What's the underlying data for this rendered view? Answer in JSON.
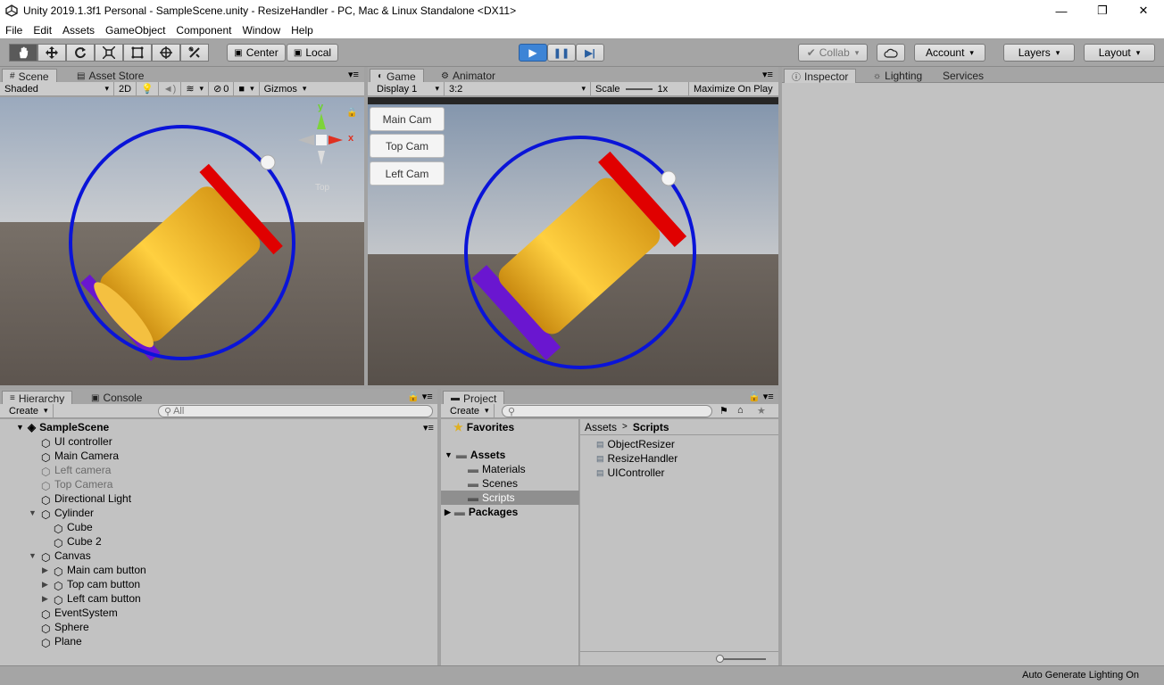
{
  "window": {
    "title": "Unity 2019.1.3f1 Personal - SampleScene.unity - ResizeHandler - PC, Mac & Linux Standalone <DX11>",
    "minimize": "—",
    "maximize": "❐",
    "close": "✕"
  },
  "menu": [
    "File",
    "Edit",
    "Assets",
    "GameObject",
    "Component",
    "Window",
    "Help"
  ],
  "toolbar": {
    "tools": [
      "hand-icon",
      "move-icon",
      "rotate-icon",
      "scale-icon",
      "rect-tool-icon",
      "transform-tool-icon",
      "custom-tool-icon"
    ],
    "pivot": "Center",
    "space": "Local",
    "play": "▶",
    "pause": "❚❚",
    "step": "▶|",
    "collab": "Collab",
    "account": "Account",
    "layers": "Layers",
    "layout": "Layout"
  },
  "scene_panel": {
    "tabs": [
      "Scene",
      "Asset Store"
    ],
    "shading": "Shaded",
    "mode2d": "2D",
    "fx_count": "0",
    "gizmos": "Gizmos",
    "gizmo_label": "Top",
    "axis_y": "y",
    "axis_x": "x"
  },
  "game_panel": {
    "tabs": [
      "Game",
      "Animator"
    ],
    "display": "Display 1",
    "aspect": "3:2",
    "scale_label": "Scale",
    "scale_value": "1x",
    "maximize": "Maximize On Play",
    "buttons": [
      "Main Cam",
      "Top Cam",
      "Left Cam"
    ]
  },
  "inspector": {
    "tabs": [
      "Inspector",
      "Lighting",
      "Services"
    ]
  },
  "hierarchy": {
    "tabs": [
      "Hierarchy",
      "Console"
    ],
    "create": "Create",
    "search_placeholder": "All",
    "scene": "SampleScene",
    "items": [
      {
        "label": "UI controller",
        "dim": false
      },
      {
        "label": "Main Camera",
        "dim": false
      },
      {
        "label": "Left camera",
        "dim": true
      },
      {
        "label": "Top Camera",
        "dim": true
      },
      {
        "label": "Directional Light",
        "dim": false
      },
      {
        "label": "Cylinder",
        "dim": false
      },
      {
        "label": "Cube",
        "dim": false
      },
      {
        "label": "Cube 2",
        "dim": false
      },
      {
        "label": "Canvas",
        "dim": false
      },
      {
        "label": "Main cam button",
        "dim": false
      },
      {
        "label": "Top cam button",
        "dim": false
      },
      {
        "label": "Left cam button",
        "dim": false
      },
      {
        "label": "EventSystem",
        "dim": false
      },
      {
        "label": "Sphere",
        "dim": false
      },
      {
        "label": "Plane",
        "dim": false
      }
    ]
  },
  "project": {
    "tab": "Project",
    "create": "Create",
    "favorites": "Favorites",
    "assets": "Assets",
    "folders": [
      "Materials",
      "Scenes",
      "Scripts"
    ],
    "packages": "Packages",
    "breadcrumb": [
      "Assets",
      "Scripts"
    ],
    "files": [
      "ObjectResizer",
      "ResizeHandler",
      "UIController"
    ]
  },
  "status": {
    "text": "Auto Generate Lighting On"
  },
  "colors": {
    "accent": "#3d84d6",
    "ring": "#0a14d8",
    "cylinder": "#f0b020",
    "red_cap": "#e00000",
    "purple_cap": "#6a16d0"
  }
}
